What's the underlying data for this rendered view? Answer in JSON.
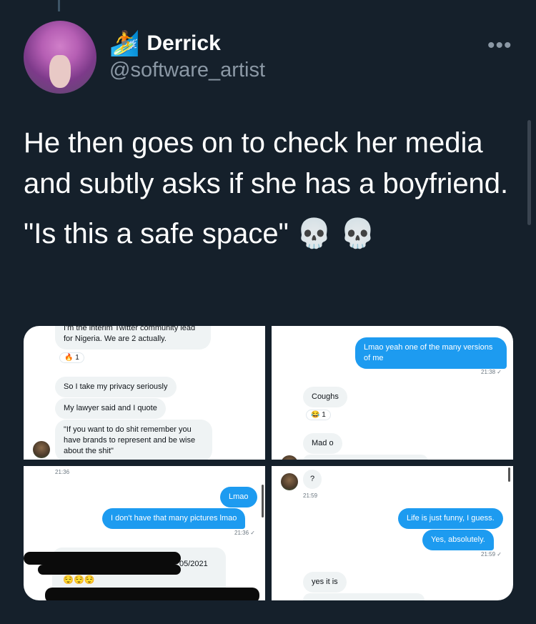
{
  "author": {
    "display_name": "Derrick",
    "handle": "@software_artist",
    "name_emoji": "🏄",
    "more_label": "•••"
  },
  "tweet": {
    "line1": "He then goes on to check her media and subtly asks if she has a boyfriend.",
    "line2": "\"Is this a safe space\" 💀 💀"
  },
  "media": {
    "panel1": {
      "msg_top": "I'm the interim Twitter community lead for Nigeria. We are 2 actually.",
      "reaction": "🔥 1",
      "msg_privacy": "So I take my privacy seriously",
      "msg_lawyer": "My lawyer said and I quote",
      "msg_quote": "\"If you want to do shit remember you have brands to represent and be wise about the shit\""
    },
    "panel2": {
      "msg_versions": "Lmao yeah one of the many versions of me",
      "time1": "21:38 ✓",
      "msg_coughs": "Coughs",
      "reaction": "😂 1",
      "msg_mad": "Mad o"
    },
    "panel3": {
      "time_top": "21:36",
      "msg_lmao": "Lmao",
      "msg_pictures": "I don't have that many pictures lmao",
      "time2": "21:36 ✓",
      "date_partial": "05/2021",
      "emojis": "😌😌😌"
    },
    "panel4": {
      "msg_q": "?",
      "time1": "21:59",
      "msg_life": "Life is just funny, I guess.",
      "msg_yes": "Yes, absolutely.",
      "time2": "21:59 ✓",
      "msg_yesitis": "yes it is"
    }
  }
}
